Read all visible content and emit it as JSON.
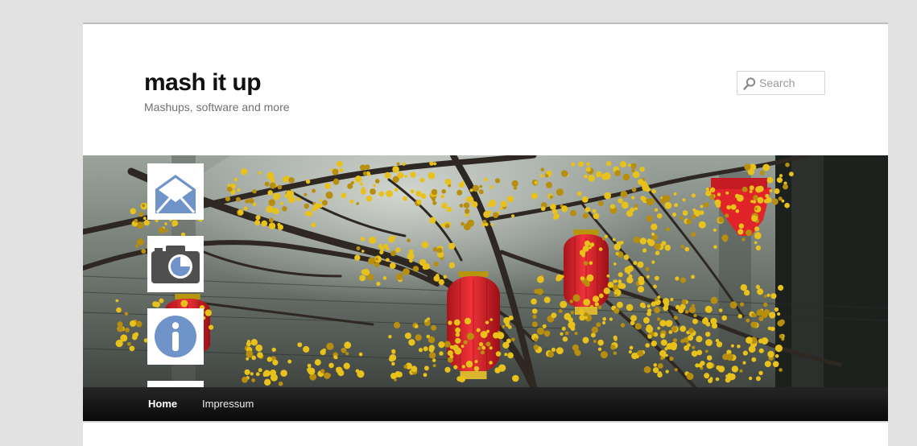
{
  "site": {
    "title": "mash it up",
    "description": "Mashups, software and more"
  },
  "search": {
    "placeholder": "Search",
    "icon": "magnifier-icon"
  },
  "side_icons": [
    {
      "icon": "envelope-icon",
      "color": "#7093c9"
    },
    {
      "icon": "camera-icon",
      "color": "#5a5a5a"
    },
    {
      "icon": "info-icon",
      "color": "#7093c9"
    }
  ],
  "nav": {
    "items": [
      {
        "label": "Home",
        "current": true
      },
      {
        "label": "Impressum",
        "current": false
      }
    ]
  },
  "colors": {
    "page_background": "#e2e2e2",
    "nav_background": "#111111",
    "lantern_red": "#e1242a",
    "blossom_yellow": "#e8c21a",
    "icon_blue": "#7093c9"
  }
}
